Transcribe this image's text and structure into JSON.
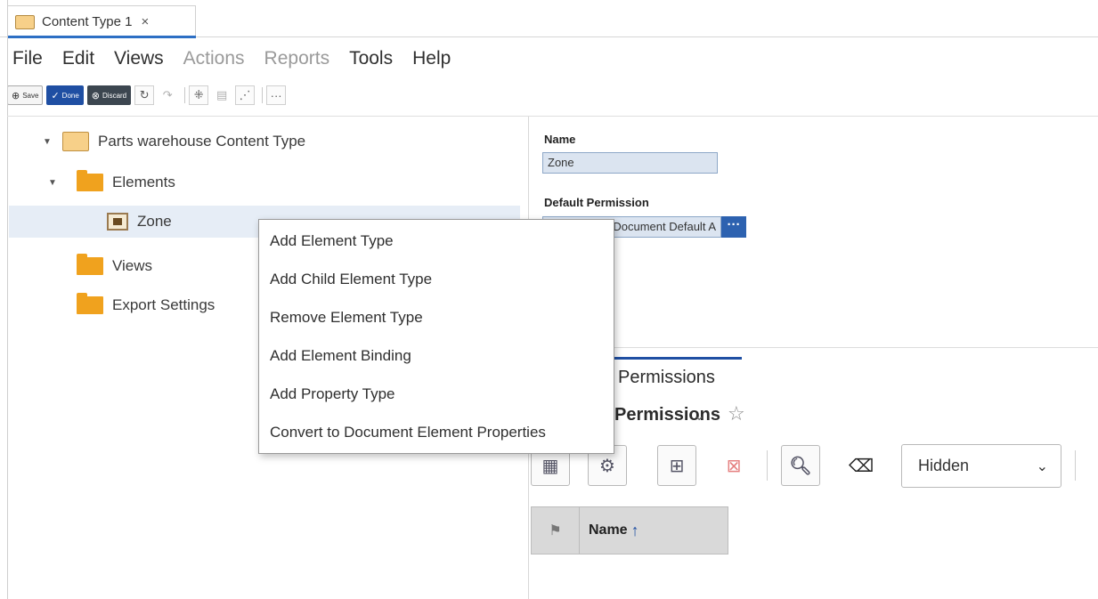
{
  "tab": {
    "label": "Content Type 1",
    "close": "×"
  },
  "menu": [
    "File",
    "Edit",
    "Views",
    "Actions",
    "Reports",
    "Tools",
    "Help"
  ],
  "toolbar": {
    "save_label": "Save",
    "done_label": "Done",
    "discard_label": "Discard",
    "more_label": "···"
  },
  "tree": {
    "root": "Parts warehouse Content Type",
    "elements": "Elements",
    "zone": "Zone",
    "views": "Views",
    "export": "Export Settings"
  },
  "context_menu": [
    "Add Element Type",
    "Add Child Element Type",
    "Remove Element Type",
    "Add Element Binding",
    "Add Property Type",
    "Convert to Document Element Properties"
  ],
  "properties": {
    "name_label": "Name",
    "name_value": "Zone",
    "permission_label": "Default Permission",
    "permission_value": "Document Default A",
    "permission_button": "···"
  },
  "permissions": {
    "tab_label": "Permissions",
    "heading": "Permissions",
    "visibility_value": "Hidden",
    "column_name": "Name",
    "sort_icon": "arrow-up-icon"
  },
  "colors": {
    "accent": "#1f4fa3",
    "folder": "#f0a21e",
    "selection": "#e6edf6"
  }
}
